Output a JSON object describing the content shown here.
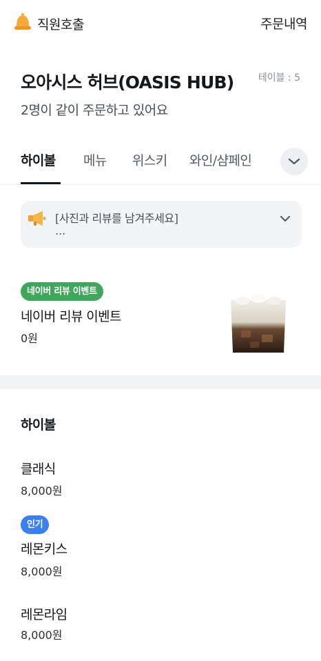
{
  "header": {
    "call_label": "직원호출",
    "orders_label": "주문내역"
  },
  "store": {
    "name": "오아시스 허브(OASIS HUB)",
    "table": "테이블 : 5",
    "together": "2명이 같이 주문하고 있어요"
  },
  "tabs": [
    {
      "label": "하이볼",
      "active": true
    },
    {
      "label": "메뉴",
      "active": false
    },
    {
      "label": "위스키",
      "active": false
    },
    {
      "label": "와인/샴페인",
      "active": false
    }
  ],
  "notice": {
    "title": "[사진과 리뷰를 남겨주세요]",
    "body": "..."
  },
  "event": {
    "badge": "네이버 리뷰 이벤트",
    "name": "네이버 리뷰 이벤트",
    "price": "0원"
  },
  "section": {
    "title": "하이볼",
    "items": [
      {
        "name": "클래식",
        "price": "8,000원",
        "badge": ""
      },
      {
        "name": "레몬키스",
        "price": "8,000원",
        "badge": "인기"
      },
      {
        "name": "레몬라임",
        "price": "8,000원",
        "badge": ""
      }
    ]
  },
  "colors": {
    "accent_green": "#3fa65c",
    "accent_blue": "#3b7ff0",
    "bell": "#f4a93a"
  },
  "icons": {
    "call": "bell-icon",
    "notice": "megaphone-icon",
    "tabs_more": "chevron-down-icon",
    "notice_expand": "chevron-down-icon"
  }
}
